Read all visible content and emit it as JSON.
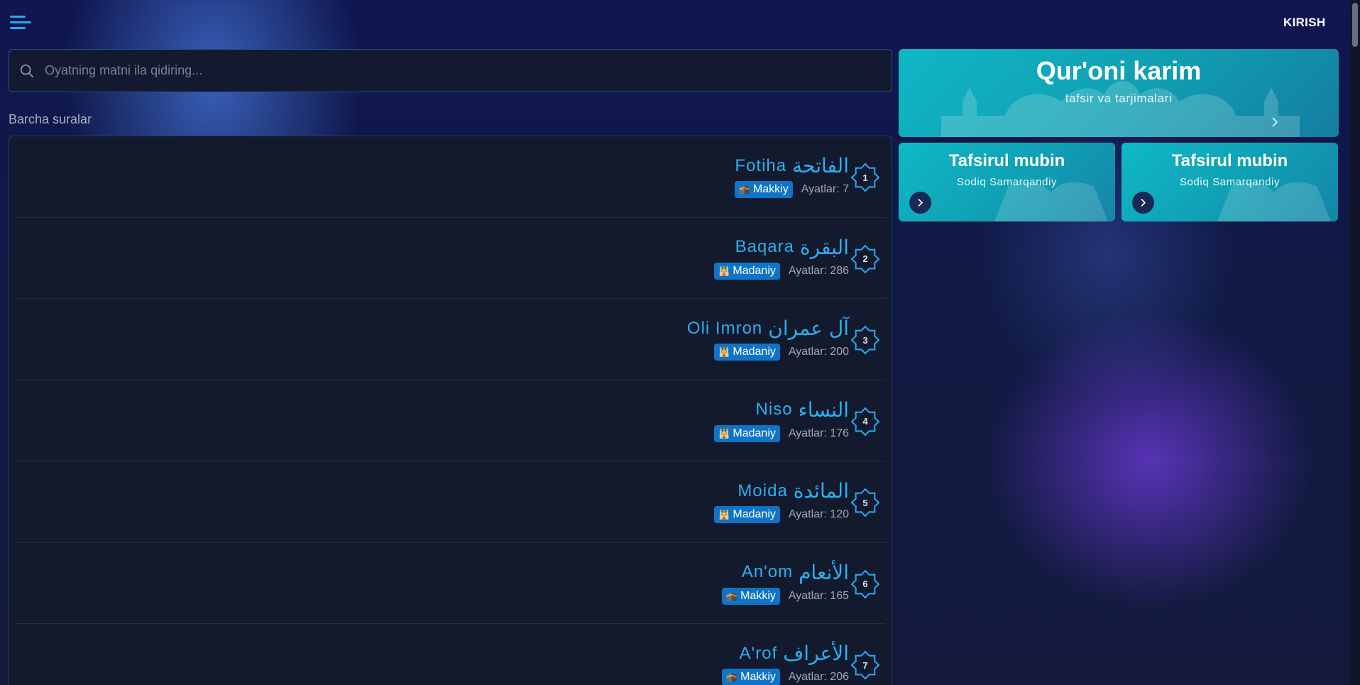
{
  "header": {
    "login_label": "KIRISH"
  },
  "search": {
    "placeholder": "Oyatning matni ila qidiring..."
  },
  "list": {
    "title": "Barcha suralar",
    "ayat_prefix": "Ayatlar:",
    "surahs": [
      {
        "number": "1",
        "latin": "Fotiha",
        "arabic": "الفاتحة",
        "type": "Makkiy",
        "type_icon": "kaaba-icon",
        "ayat_count": "7"
      },
      {
        "number": "2",
        "latin": "Baqara",
        "arabic": "البقرة",
        "type": "Madaniy",
        "type_icon": "mosque-icon",
        "ayat_count": "286"
      },
      {
        "number": "3",
        "latin": "Oli Imron",
        "arabic": "آل عمران",
        "type": "Madaniy",
        "type_icon": "mosque-icon",
        "ayat_count": "200"
      },
      {
        "number": "4",
        "latin": "Niso",
        "arabic": "النساء",
        "type": "Madaniy",
        "type_icon": "mosque-icon",
        "ayat_count": "176"
      },
      {
        "number": "5",
        "latin": "Moida",
        "arabic": "المائدة",
        "type": "Madaniy",
        "type_icon": "mosque-icon",
        "ayat_count": "120"
      },
      {
        "number": "6",
        "latin": "An'om",
        "arabic": "الأنعام",
        "type": "Makkiy",
        "type_icon": "kaaba-icon",
        "ayat_count": "165"
      },
      {
        "number": "7",
        "latin": "A'rof",
        "arabic": "الأعراف",
        "type": "Makkiy",
        "type_icon": "kaaba-icon",
        "ayat_count": "206"
      }
    ]
  },
  "hero": {
    "title": "Qur'oni karim",
    "subtitle": "tafsir va tarjimalari"
  },
  "cards": [
    {
      "title": "Tafsirul mubin",
      "subtitle": "Sodiq Samarqandiy"
    },
    {
      "title": "Tafsirul mubin",
      "subtitle": "Sodiq Samarqandiy"
    }
  ],
  "colors": {
    "accent": "#2bb0ee",
    "badge": "#0f74c8",
    "card": "#10b7c5"
  }
}
